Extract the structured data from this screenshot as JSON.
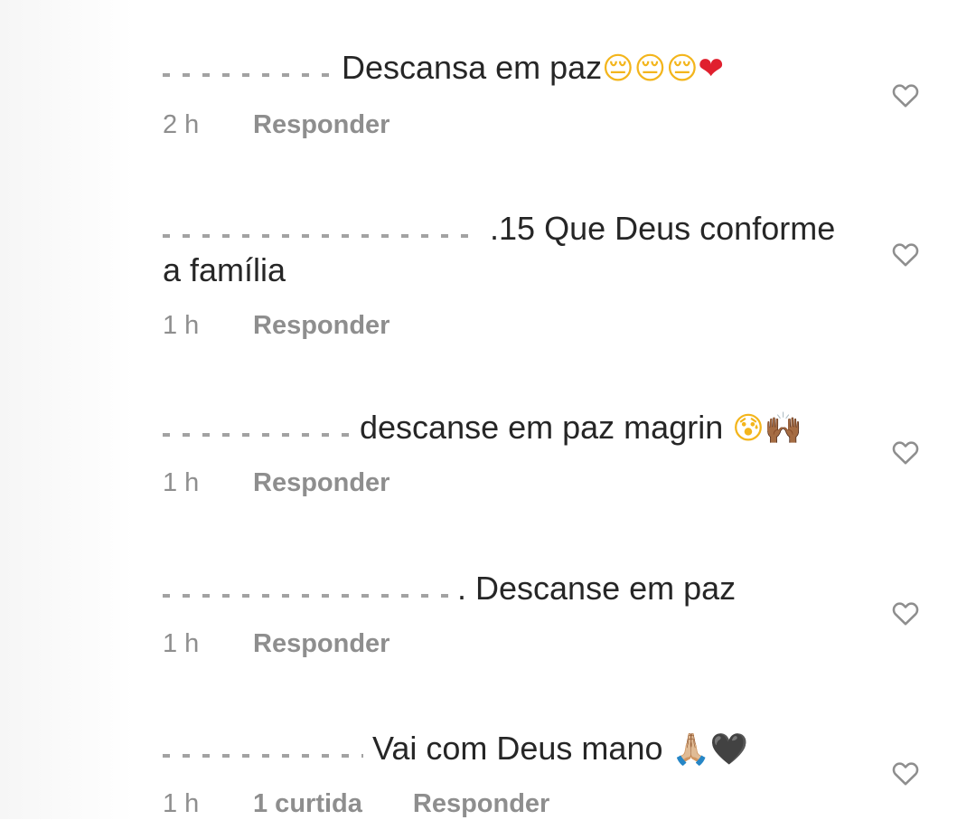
{
  "comments": [
    {
      "text": "Descansa em paz",
      "emojis": "😔😔😔❤",
      "time": "2 h",
      "reply_label": "Responder",
      "like_icon": "heart-outline-icon"
    },
    {
      "text": ".15 Que Deus conforme a família",
      "emojis": "",
      "time": "1 h",
      "reply_label": "Responder",
      "like_icon": "heart-outline-icon"
    },
    {
      "text": "descanse em paz magrin",
      "emojis": "😰🙌🏾",
      "time": "1 h",
      "reply_label": "Responder",
      "like_icon": "heart-outline-icon"
    },
    {
      "text": ". Descanse em paz",
      "emojis": "",
      "time": "1 h",
      "reply_label": "Responder",
      "like_icon": "heart-outline-icon"
    },
    {
      "text": "Vai com Deus mano",
      "emojis": "🙏🏼🖤",
      "time": "1 h",
      "likes_label": "1 curtida",
      "reply_label": "Responder",
      "like_icon": "heart-outline-icon"
    }
  ],
  "colors": {
    "text": "#262626",
    "meta": "#8e8e8e",
    "heart_outline": "#8e8e8e",
    "background": "#ffffff"
  }
}
